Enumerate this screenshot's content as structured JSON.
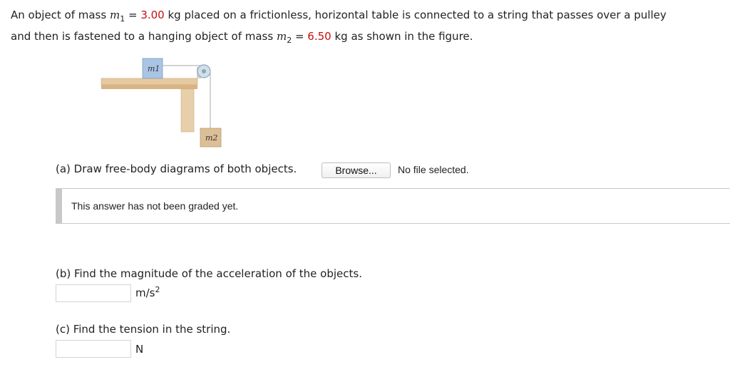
{
  "problem": {
    "part1": "An object of mass ",
    "m1_symbol": "m",
    "m1_sub": "1",
    "eq1": " = ",
    "m1_value": "3.00",
    "part2": " kg placed on a frictionless, horizontal table is connected to a string that passes over a pulley",
    "part3": "and then is fastened to a hanging object of mass ",
    "m2_symbol": "m",
    "m2_sub": "2",
    "eq2": " = ",
    "m2_value": "6.50",
    "part4": " kg as shown in the figure."
  },
  "figure": {
    "m1_label": "m1",
    "m2_label": "m2"
  },
  "question_a": {
    "text": "(a) Draw free-body diagrams of both objects.",
    "browse_label": "Browse...",
    "file_status": "No file selected.",
    "graded_text": "This answer has not been graded yet."
  },
  "question_b": {
    "text": "(b) Find the magnitude of the acceleration of the objects.",
    "answer_value": "",
    "unit": "m/s",
    "unit_exp": "2"
  },
  "question_c": {
    "text": "(c) Find the tension in the string.",
    "answer_value": "",
    "unit": "N"
  },
  "colors": {
    "given_value": "#c41010",
    "table_wood": "#e7c9a1",
    "block_m1": "#a9c4e4",
    "block_m2": "#dcbf97",
    "graded_border": "#c8c8c8"
  }
}
